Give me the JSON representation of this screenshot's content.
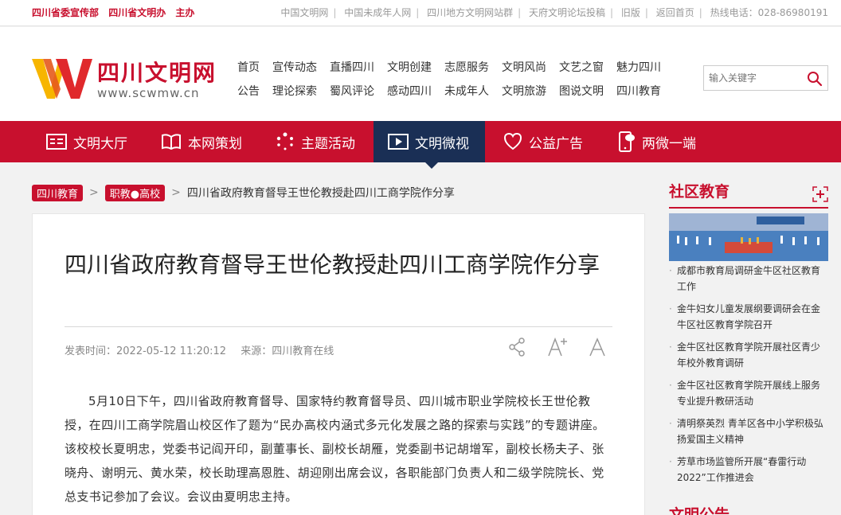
{
  "topbar": {
    "sponsors": [
      "四川省委宣传部",
      "四川省文明办",
      "主办"
    ],
    "links": [
      "中国文明网",
      "中国未成年人网",
      "四川地方文明网站群",
      "天府文明论坛投稿",
      "旧版",
      "返回首页",
      "热线电话：028-86980191"
    ]
  },
  "logo": {
    "title": "四川文明网",
    "domain": "www.scwmw.cn"
  },
  "topnav": {
    "row1": [
      "首页",
      "宣传动态",
      "直播四川",
      "文明创建",
      "志愿服务",
      "文明风尚",
      "文艺之窗",
      "魅力四川"
    ],
    "row2": [
      "公告",
      "理论探索",
      "蜀风评论",
      "感动四川",
      "未成年人",
      "文明旅游",
      "图说文明",
      "四川教育"
    ]
  },
  "search": {
    "placeholder": "输入关键字"
  },
  "mainnav": [
    "文明大厅",
    "本网策划",
    "主题活动",
    "文明微视",
    "公益广告",
    "两微一端"
  ],
  "breadcrumb": {
    "tag1": "四川教育",
    "tag2": "职教●高校",
    "current": "四川省政府教育督导王世伦教授赴四川工商学院作分享"
  },
  "article": {
    "title": "四川省政府教育督导王世伦教授赴四川工商学院作分享",
    "time": "发表时间：2022-05-12 11:20:12",
    "source": "来源：四川教育在线",
    "body": "5月10日下午，四川省政府教育督导、国家特约教育督导员、四川城市职业学院校长王世伦教授，在四川工商学院眉山校区作了题为“民办高校内涵式多元化发展之路的探索与实践”的专题讲座。该校校长夏明忠，党委书记阎开印，副董事长、副校长胡雁，党委副书记胡增军，副校长杨夫子、张晓舟、谢明元、黄水荣，校长助理高恩胜、胡迎刚出席会议，各职能部门负责人和二级学院院长、党总支书记参加了会议。会议由夏明忠主持。"
  },
  "sidebar": {
    "title": "社区教育",
    "items": [
      "成都市教育局调研金牛区社区教育工作",
      "金牛妇女儿童发展纲要调研会在金牛区社区教育学院召开",
      "金牛区社区教育学院开展社区青少年校外教育调研",
      "金牛区社区教育学院开展线上服务专业提升教研活动",
      "清明祭英烈 青羊区各中小学积极弘扬爱国主义精神",
      "芳草市场监管所开展“春雷行动2022”工作推进会"
    ],
    "title2": "文明公告"
  },
  "colors": {
    "brand": "#c8102e",
    "active_nav": "#1a2f55"
  }
}
